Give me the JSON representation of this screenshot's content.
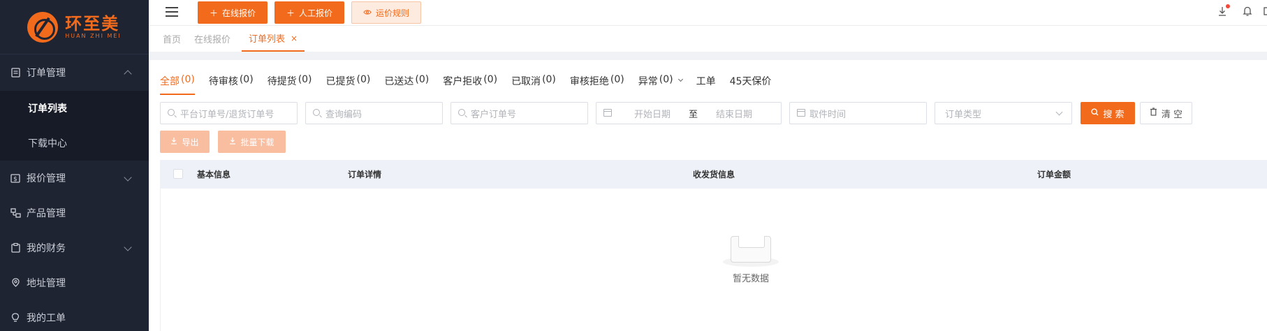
{
  "brand": {
    "name_cn": "环至美",
    "name_en": "HUAN ZHI MEI",
    "accent": "#f26b1d"
  },
  "sidebar": {
    "items": [
      {
        "label": "订单管理",
        "icon": "document-icon",
        "expanded": true,
        "children": [
          {
            "label": "订单列表",
            "active": true
          },
          {
            "label": "下载中心"
          }
        ]
      },
      {
        "label": "报价管理",
        "icon": "dollar-icon",
        "expandable": true
      },
      {
        "label": "产品管理",
        "icon": "product-icon"
      },
      {
        "label": "我的财务",
        "icon": "clipboard-icon",
        "expandable": true
      },
      {
        "label": "地址管理",
        "icon": "location-icon"
      },
      {
        "label": "我的工单",
        "icon": "bulb-icon"
      }
    ]
  },
  "header": {
    "buttons": [
      {
        "label": "在线报价",
        "icon": "plus-icon"
      },
      {
        "label": "人工报价",
        "icon": "plus-icon"
      },
      {
        "label": "运价规则",
        "icon": "eye-icon"
      }
    ]
  },
  "page_tabs": [
    {
      "label": "首页"
    },
    {
      "label": "在线报价"
    },
    {
      "label": "订单列表",
      "close": "×",
      "active": true
    }
  ],
  "status_tabs": [
    {
      "label": "全部",
      "count": "(0)",
      "active": true
    },
    {
      "label": "待审核",
      "count": "(0)"
    },
    {
      "label": "待提货",
      "count": "(0)"
    },
    {
      "label": "已提货",
      "count": "(0)"
    },
    {
      "label": "已送达",
      "count": "(0)"
    },
    {
      "label": "客户拒收",
      "count": "(0)"
    },
    {
      "label": "已取消",
      "count": "(0)"
    },
    {
      "label": "审核拒绝",
      "count": "(0)"
    },
    {
      "label": "异常",
      "count": "(0)"
    },
    {
      "label": "工单",
      "count": ""
    },
    {
      "label": "45天保价",
      "count": ""
    }
  ],
  "filters": {
    "order_no_placeholder": "平台订单号/退货订单号",
    "query_code_placeholder": "查询编码",
    "customer_order_placeholder": "客户订单号",
    "start_date_placeholder": "开始日期",
    "range_separator": "至",
    "end_date_placeholder": "结束日期",
    "pickup_time_placeholder": "取件时间",
    "order_type_placeholder": "订单类型",
    "search_label": "搜 索",
    "clear_label": "清 空",
    "export_label": "导出",
    "batch_download_label": "批量下载"
  },
  "table": {
    "columns": [
      "基本信息",
      "订单详情",
      "收发货信息",
      "订单金额"
    ],
    "empty_text": "暂无数据"
  }
}
